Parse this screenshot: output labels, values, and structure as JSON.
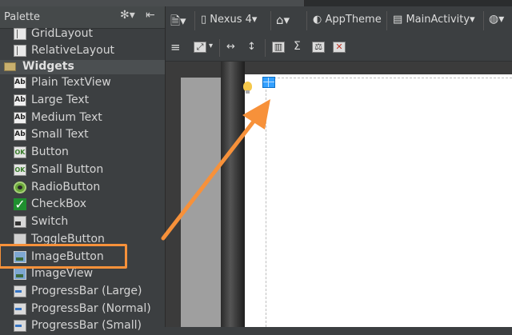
{
  "palette": {
    "title": "Palette",
    "layout_items": [
      {
        "label": "GridLayout",
        "icon": "grid-layout-icon"
      },
      {
        "label": "RelativeLayout",
        "icon": "relative-layout-icon"
      }
    ],
    "category": "Widgets",
    "widgets": [
      {
        "label": "Plain TextView",
        "icon": "textview-icon"
      },
      {
        "label": "Large Text",
        "icon": "textview-icon"
      },
      {
        "label": "Medium Text",
        "icon": "textview-icon"
      },
      {
        "label": "Small Text",
        "icon": "textview-icon"
      },
      {
        "label": "Button",
        "icon": "button-icon"
      },
      {
        "label": "Small Button",
        "icon": "button-icon"
      },
      {
        "label": "RadioButton",
        "icon": "radio-button-icon"
      },
      {
        "label": "CheckBox",
        "icon": "checkbox-icon"
      },
      {
        "label": "Switch",
        "icon": "switch-icon"
      },
      {
        "label": "ToggleButton",
        "icon": "toggle-button-icon"
      },
      {
        "label": "ImageButton",
        "icon": "image-button-icon"
      },
      {
        "label": "ImageView",
        "icon": "image-view-icon"
      },
      {
        "label": "ProgressBar (Large)",
        "icon": "progress-bar-icon"
      },
      {
        "label": "ProgressBar (Normal)",
        "icon": "progress-bar-icon"
      },
      {
        "label": "ProgressBar (Small)",
        "icon": "progress-bar-icon"
      }
    ],
    "highlighted": "ImageButton"
  },
  "toolbar": {
    "device": "Nexus 4",
    "theme": "AppTheme",
    "activity": "MainActivity"
  },
  "colors": {
    "highlight_outline": "#f7913a",
    "arrow": "#f7913a",
    "selection": "#33a0ff"
  }
}
